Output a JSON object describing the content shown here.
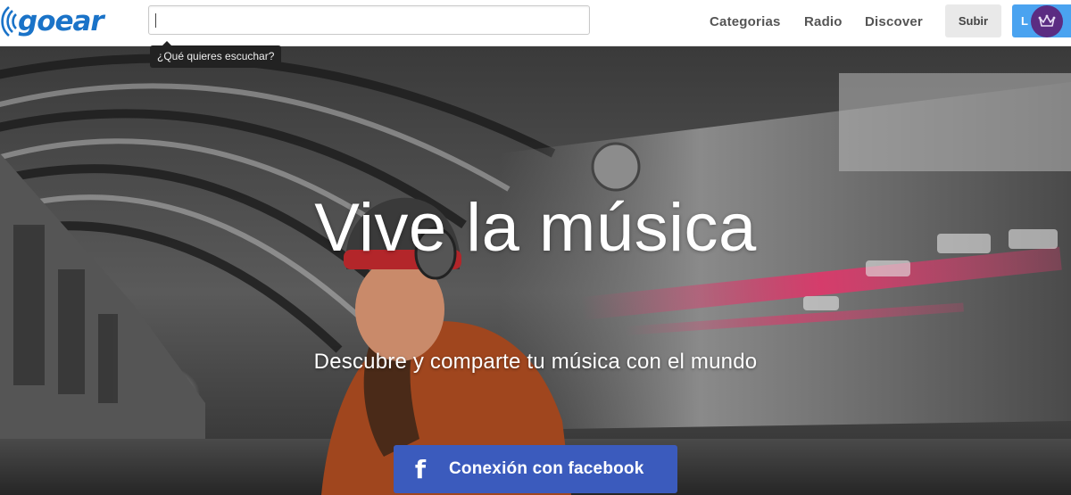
{
  "header": {
    "logo_text": "goear",
    "search": {
      "value": "",
      "placeholder": ""
    },
    "search_tooltip": "¿Qué quieres escuchar?",
    "nav": [
      {
        "label": "Categorias"
      },
      {
        "label": "Radio"
      },
      {
        "label": "Discover"
      }
    ],
    "upload_label": "Subir",
    "login_label": "L",
    "avatar_icon": "crown-icon"
  },
  "hero": {
    "title": "Vive la música",
    "subtitle": "Descubre y comparte tu música con el mundo",
    "facebook_button_label": "Conexión con facebook",
    "facebook_icon_glyph": "f"
  },
  "colors": {
    "brand_blue": "#1a73c8",
    "login_blue": "#4aa3f0",
    "facebook_blue": "#3b5bbd",
    "avatar_purple": "#5b2c82"
  }
}
